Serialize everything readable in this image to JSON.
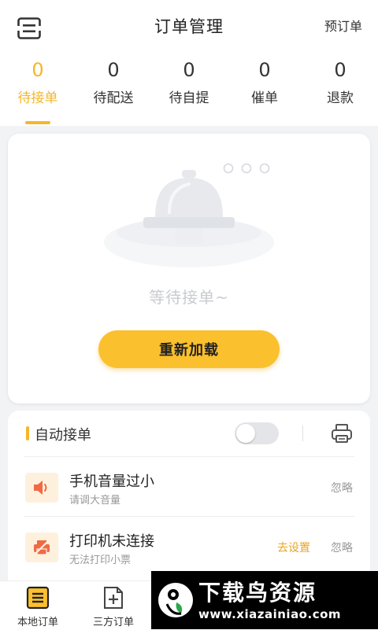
{
  "header": {
    "title": "订单管理",
    "preorder_label": "预订单",
    "menu_icon": "menu-icon"
  },
  "tabs": [
    {
      "count": "0",
      "label": "待接单",
      "active": true
    },
    {
      "count": "0",
      "label": "待配送",
      "active": false
    },
    {
      "count": "0",
      "label": "待自提",
      "active": false
    },
    {
      "count": "0",
      "label": "催单",
      "active": false
    },
    {
      "count": "0",
      "label": "退款",
      "active": false
    }
  ],
  "empty_state": {
    "illustration_icon": "service-bell-icon",
    "text": "等待接单~",
    "reload_label": "重新加载"
  },
  "settings": {
    "auto_accept_label": "自动接单",
    "auto_accept_on": false,
    "printer_icon": "printer-icon",
    "alerts": [
      {
        "icon": "speaker-icon",
        "title": "手机音量过小",
        "subtitle": "请调大音量",
        "ignore_label": "忽略"
      },
      {
        "icon": "printer-off-icon",
        "title": "打印机未连接",
        "subtitle": "无法打印小票",
        "action_label": "去设置",
        "ignore_label": "忽略"
      }
    ]
  },
  "bottom_nav": [
    {
      "label": "本地订单",
      "icon": "order-list-icon"
    },
    {
      "label": "三方订单",
      "icon": "add-document-icon"
    }
  ],
  "watermark": {
    "title": "下载鸟资源",
    "url": "www.xiazainiao.com"
  },
  "colors": {
    "accent": "#f5b62b",
    "button": "#fbc02d",
    "background": "#f2f3f5"
  }
}
